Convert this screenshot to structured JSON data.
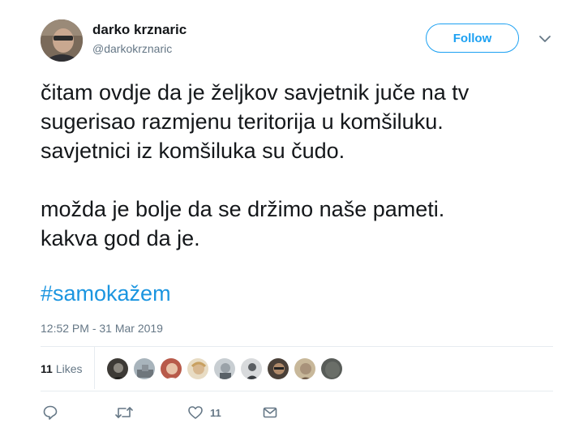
{
  "author": {
    "name": "darko krznaric",
    "handle": "@darkokrznaric"
  },
  "follow_label": "Follow",
  "tweet": {
    "lines": [
      "čitam ovdje da je željkov savjetnik juče na tv",
      "sugerisao razmjenu teritorija u komšiluku.",
      "savjetnici iz komšiluka su čudo.",
      "",
      "možda je bolje da se držimo naše pameti.",
      "kakva god da je."
    ],
    "hashtag": "#samokažem",
    "timestamp": "12:52 PM - 31 Mar 2019"
  },
  "likes": {
    "count": "11",
    "label": "Likes",
    "faces": [
      "#3d3a36",
      "#8a9299",
      "#b85a4a",
      "#d8c8a8",
      "#9aa2a8",
      "#5a5e62",
      "#6e5a48",
      "#a8927a",
      "#585c58"
    ]
  },
  "actions": {
    "reply_icon": "reply-icon",
    "retweet_icon": "retweet-icon",
    "like_icon": "heart-icon",
    "like_count": "11",
    "dm_icon": "mail-icon"
  },
  "colors": {
    "accent": "#1da1f2",
    "hashtag": "#1b95e0",
    "muted": "#657786",
    "divider": "#e6ecf0"
  }
}
